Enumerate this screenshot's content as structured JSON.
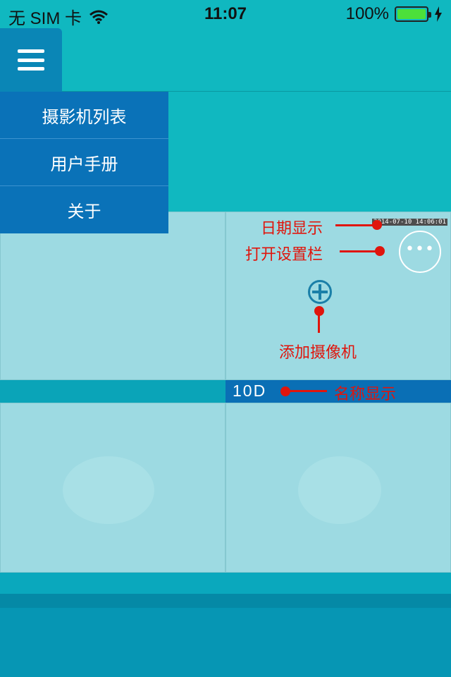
{
  "status_bar": {
    "carrier": "无 SIM 卡",
    "time": "11:07",
    "battery_percent": "100%",
    "battery_level": 1.0,
    "icons": [
      "wifi-icon",
      "battery-icon",
      "charging-bolt-icon"
    ]
  },
  "menu": {
    "items": [
      {
        "label": "摄影机列表"
      },
      {
        "label": "用户手册"
      },
      {
        "label": "关于"
      }
    ]
  },
  "camera_cell": {
    "date_stamp": "2014-07-10 14:06:01",
    "name": "10D",
    "icons": [
      "more-options-icon",
      "add-camera-icon"
    ]
  },
  "annotations": {
    "date_display": "日期显示",
    "open_settings": "打开设置栏",
    "add_camera": "添加摄像机",
    "name_display": "名称显示"
  },
  "colors": {
    "background": "#10b8c0",
    "menu": "#0a72b8",
    "annotation": "#e0150c",
    "name_bar": "#0a6fb5"
  }
}
